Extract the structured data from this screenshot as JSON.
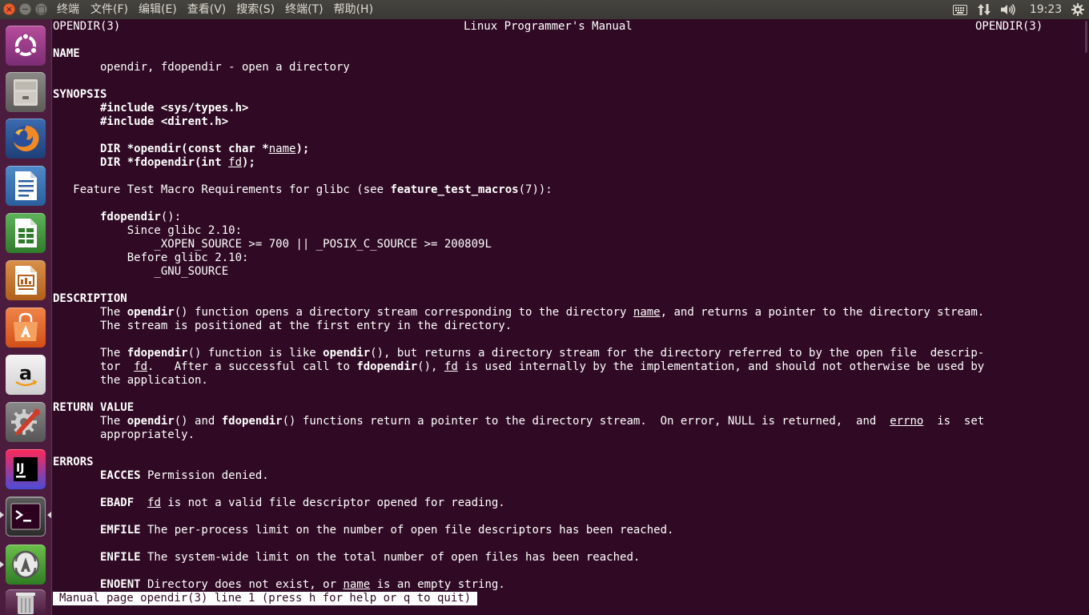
{
  "topbar": {
    "app_title": "终端",
    "menus": [
      "文件(F)",
      "编辑(E)",
      "查看(V)",
      "搜索(S)",
      "终端(T)",
      "帮助(H)"
    ],
    "clock": "19:23"
  },
  "launcher": {
    "items": [
      "ubuntu-dash",
      "files",
      "firefox",
      "libreoffice-writer",
      "libreoffice-calc",
      "libreoffice-impress",
      "ubuntu-software",
      "amazon",
      "system-settings",
      "intellij-idea",
      "terminal",
      "software-updater",
      "trash"
    ]
  },
  "man": {
    "header_left": "OPENDIR(3)",
    "header_center": "Linux Programmer's Manual",
    "header_right": "OPENDIR(3)",
    "name": {
      "heading": "NAME",
      "line": "       opendir, fdopendir - open a directory"
    },
    "synopsis": {
      "heading": "SYNOPSIS",
      "inc1": "       #include <sys/types.h>",
      "inc2": "       #include <dirent.h>",
      "d1_pre": "       DIR *opendir(const char *",
      "d1_arg": "name",
      "d1_post": ");",
      "d2_pre": "       DIR *fdopendir(int ",
      "d2_arg": "fd",
      "d2_post": ");",
      "ftm_pre": "   Feature Test Macro Requirements for glibc (see ",
      "ftm_bold": "feature_test_macros",
      "ftm_post": "(7)):",
      "fdop_bold": "       fdopendir",
      "fdop_post": "():",
      "since": "           Since glibc 2.10:",
      "since_val": "               _XOPEN_SOURCE >= 700 || _POSIX_C_SOURCE >= 200809L",
      "before": "           Before glibc 2.10:",
      "before_val": "               _GNU_SOURCE"
    },
    "description": {
      "heading": "DESCRIPTION",
      "p1a_1": "       The ",
      "p1a_b1": "opendir",
      "p1a_2": "() function opens a directory stream corresponding to the directory ",
      "p1a_u1": "name",
      "p1a_3": ", and returns a pointer to the directory stream.",
      "p1b": "       The stream is positioned at the first entry in the directory.",
      "p2a_1": "       The ",
      "p2a_b1": "fdopendir",
      "p2a_2": "() function is like ",
      "p2a_b2": "opendir",
      "p2a_3": "(), but returns a directory stream for the directory referred to by the open file  descrip‐",
      "p2b_1": "       tor  ",
      "p2b_u1": "fd",
      "p2b_2": ".   After a successful call to ",
      "p2b_b1": "fdopendir",
      "p2b_3": "(), ",
      "p2b_u2": "fd",
      "p2b_4": " is used internally by the implementation, and should not otherwise be used by",
      "p2c": "       the application."
    },
    "return_value": {
      "heading": "RETURN VALUE",
      "l1_1": "       The ",
      "l1_b1": "opendir",
      "l1_2": "() and ",
      "l1_b2": "fdopendir",
      "l1_3": "() functions return a pointer to the directory stream.  On error, NULL is returned,  and  ",
      "l1_u1": "errno",
      "l1_4": "  is  set",
      "l2": "       appropriately."
    },
    "errors": {
      "heading": "ERRORS",
      "e1_b": "       EACCES",
      "e1_t": " Permission denied.",
      "e2_b": "       EBADF",
      "e2_s": "  ",
      "e2_u": "fd",
      "e2_t": " is not a valid file descriptor opened for reading.",
      "e3_b": "       EMFILE",
      "e3_t": " The per-process limit on the number of open file descriptors has been reached.",
      "e4_b": "       ENFILE",
      "e4_t": " The system-wide limit on the total number of open files has been reached.",
      "e5_b": "       ENOENT",
      "e5_t1": " Directory does not exist, or ",
      "e5_u": "name",
      "e5_t2": " is an empty string."
    },
    "status": "Manual page opendir(3) line 1 (press h for help or q to quit)"
  }
}
